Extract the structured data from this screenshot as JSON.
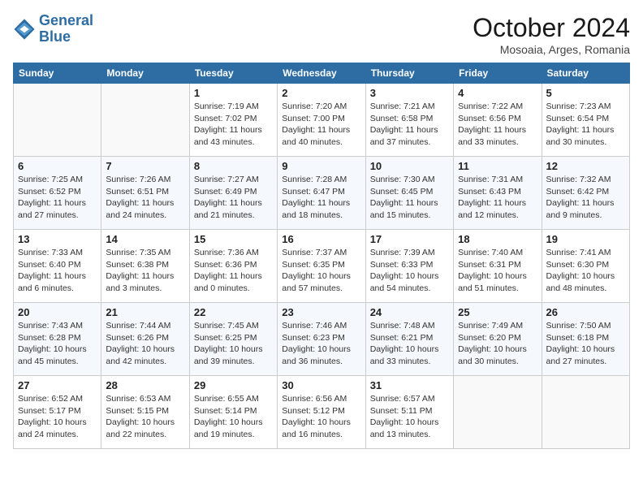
{
  "header": {
    "logo_line1": "General",
    "logo_line2": "Blue",
    "month": "October 2024",
    "location": "Mosoaia, Arges, Romania"
  },
  "days_of_week": [
    "Sunday",
    "Monday",
    "Tuesday",
    "Wednesday",
    "Thursday",
    "Friday",
    "Saturday"
  ],
  "weeks": [
    [
      {
        "day": "",
        "info": ""
      },
      {
        "day": "",
        "info": ""
      },
      {
        "day": "1",
        "info": "Sunrise: 7:19 AM\nSunset: 7:02 PM\nDaylight: 11 hours\nand 43 minutes."
      },
      {
        "day": "2",
        "info": "Sunrise: 7:20 AM\nSunset: 7:00 PM\nDaylight: 11 hours\nand 40 minutes."
      },
      {
        "day": "3",
        "info": "Sunrise: 7:21 AM\nSunset: 6:58 PM\nDaylight: 11 hours\nand 37 minutes."
      },
      {
        "day": "4",
        "info": "Sunrise: 7:22 AM\nSunset: 6:56 PM\nDaylight: 11 hours\nand 33 minutes."
      },
      {
        "day": "5",
        "info": "Sunrise: 7:23 AM\nSunset: 6:54 PM\nDaylight: 11 hours\nand 30 minutes."
      }
    ],
    [
      {
        "day": "6",
        "info": "Sunrise: 7:25 AM\nSunset: 6:52 PM\nDaylight: 11 hours\nand 27 minutes."
      },
      {
        "day": "7",
        "info": "Sunrise: 7:26 AM\nSunset: 6:51 PM\nDaylight: 11 hours\nand 24 minutes."
      },
      {
        "day": "8",
        "info": "Sunrise: 7:27 AM\nSunset: 6:49 PM\nDaylight: 11 hours\nand 21 minutes."
      },
      {
        "day": "9",
        "info": "Sunrise: 7:28 AM\nSunset: 6:47 PM\nDaylight: 11 hours\nand 18 minutes."
      },
      {
        "day": "10",
        "info": "Sunrise: 7:30 AM\nSunset: 6:45 PM\nDaylight: 11 hours\nand 15 minutes."
      },
      {
        "day": "11",
        "info": "Sunrise: 7:31 AM\nSunset: 6:43 PM\nDaylight: 11 hours\nand 12 minutes."
      },
      {
        "day": "12",
        "info": "Sunrise: 7:32 AM\nSunset: 6:42 PM\nDaylight: 11 hours\nand 9 minutes."
      }
    ],
    [
      {
        "day": "13",
        "info": "Sunrise: 7:33 AM\nSunset: 6:40 PM\nDaylight: 11 hours\nand 6 minutes."
      },
      {
        "day": "14",
        "info": "Sunrise: 7:35 AM\nSunset: 6:38 PM\nDaylight: 11 hours\nand 3 minutes."
      },
      {
        "day": "15",
        "info": "Sunrise: 7:36 AM\nSunset: 6:36 PM\nDaylight: 11 hours\nand 0 minutes."
      },
      {
        "day": "16",
        "info": "Sunrise: 7:37 AM\nSunset: 6:35 PM\nDaylight: 10 hours\nand 57 minutes."
      },
      {
        "day": "17",
        "info": "Sunrise: 7:39 AM\nSunset: 6:33 PM\nDaylight: 10 hours\nand 54 minutes."
      },
      {
        "day": "18",
        "info": "Sunrise: 7:40 AM\nSunset: 6:31 PM\nDaylight: 10 hours\nand 51 minutes."
      },
      {
        "day": "19",
        "info": "Sunrise: 7:41 AM\nSunset: 6:30 PM\nDaylight: 10 hours\nand 48 minutes."
      }
    ],
    [
      {
        "day": "20",
        "info": "Sunrise: 7:43 AM\nSunset: 6:28 PM\nDaylight: 10 hours\nand 45 minutes."
      },
      {
        "day": "21",
        "info": "Sunrise: 7:44 AM\nSunset: 6:26 PM\nDaylight: 10 hours\nand 42 minutes."
      },
      {
        "day": "22",
        "info": "Sunrise: 7:45 AM\nSunset: 6:25 PM\nDaylight: 10 hours\nand 39 minutes."
      },
      {
        "day": "23",
        "info": "Sunrise: 7:46 AM\nSunset: 6:23 PM\nDaylight: 10 hours\nand 36 minutes."
      },
      {
        "day": "24",
        "info": "Sunrise: 7:48 AM\nSunset: 6:21 PM\nDaylight: 10 hours\nand 33 minutes."
      },
      {
        "day": "25",
        "info": "Sunrise: 7:49 AM\nSunset: 6:20 PM\nDaylight: 10 hours\nand 30 minutes."
      },
      {
        "day": "26",
        "info": "Sunrise: 7:50 AM\nSunset: 6:18 PM\nDaylight: 10 hours\nand 27 minutes."
      }
    ],
    [
      {
        "day": "27",
        "info": "Sunrise: 6:52 AM\nSunset: 5:17 PM\nDaylight: 10 hours\nand 24 minutes."
      },
      {
        "day": "28",
        "info": "Sunrise: 6:53 AM\nSunset: 5:15 PM\nDaylight: 10 hours\nand 22 minutes."
      },
      {
        "day": "29",
        "info": "Sunrise: 6:55 AM\nSunset: 5:14 PM\nDaylight: 10 hours\nand 19 minutes."
      },
      {
        "day": "30",
        "info": "Sunrise: 6:56 AM\nSunset: 5:12 PM\nDaylight: 10 hours\nand 16 minutes."
      },
      {
        "day": "31",
        "info": "Sunrise: 6:57 AM\nSunset: 5:11 PM\nDaylight: 10 hours\nand 13 minutes."
      },
      {
        "day": "",
        "info": ""
      },
      {
        "day": "",
        "info": ""
      }
    ]
  ]
}
